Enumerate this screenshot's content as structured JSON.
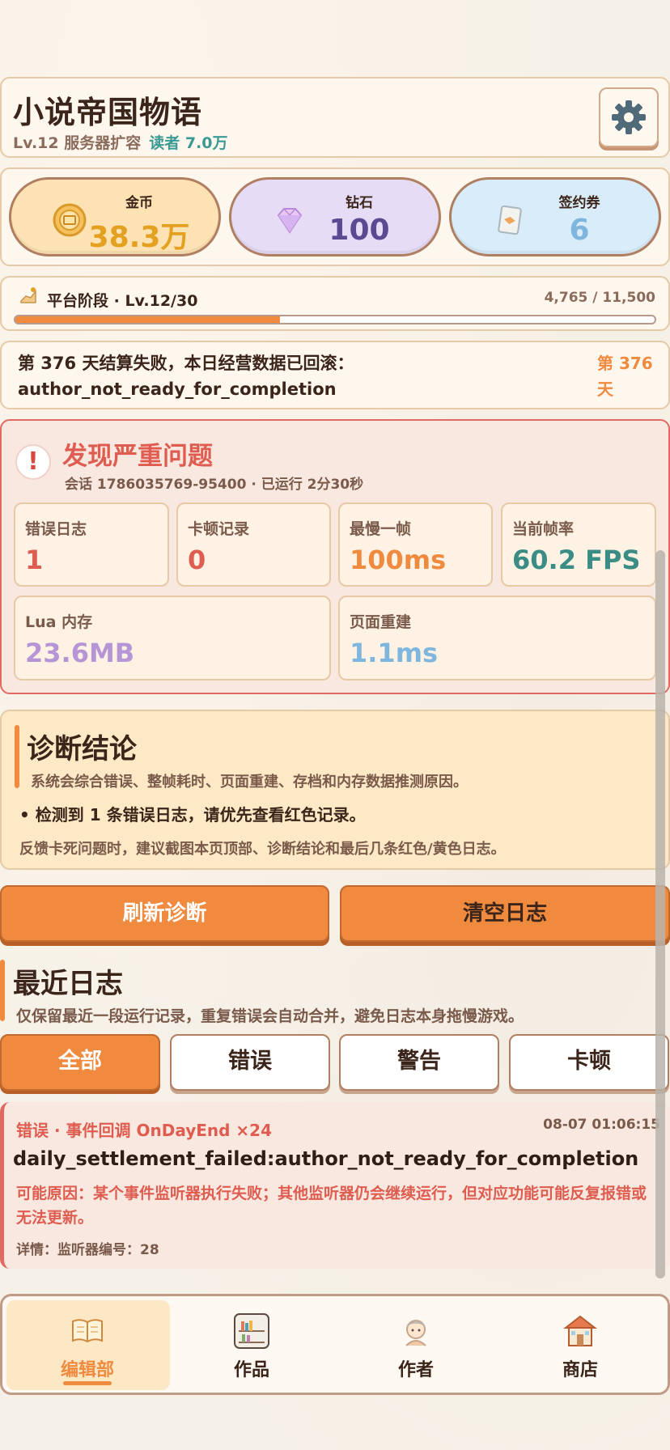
{
  "header": {
    "title": "小说帝国物语",
    "level_text": "Lv.12 服务器扩容",
    "readers_text": "读者 7.0万"
  },
  "currencies": {
    "gold": {
      "label": "金币",
      "value": "38.3万"
    },
    "gem": {
      "label": "钻石",
      "value": "100"
    },
    "ticket": {
      "label": "签约券",
      "value": "6"
    }
  },
  "stage": {
    "label": "平台阶段 · Lv.12/30",
    "count": "4,765 / 11,500",
    "progress": 0.414
  },
  "notice": {
    "text": "第 376 天结算失败，本日经营数据已回滚：author_not_ready_for_completion",
    "day": "第 376 天"
  },
  "problem": {
    "title": "发现严重问题",
    "session": "会话 1786035769-95400 · 已运行 2分30秒",
    "stats": [
      {
        "label": "错误日志",
        "value": "1"
      },
      {
        "label": "卡顿记录",
        "value": "0"
      },
      {
        "label": "最慢一帧",
        "value": "100ms"
      },
      {
        "label": "当前帧率",
        "value": "60.2 FPS"
      },
      {
        "label": "Lua 内存",
        "value": "23.6MB"
      },
      {
        "label": "页面重建",
        "value": "1.1ms"
      }
    ]
  },
  "diagnosis": {
    "title": "诊断结论",
    "subtitle": "系统会综合错误、整帧耗时、页面重建、存档和内存数据推测原因。",
    "bullet": "• 检测到 1 条错误日志，请优先查看红色记录。",
    "tip": "反馈卡死问题时，建议截图本页顶部、诊断结论和最后几条红色/黄色日志。"
  },
  "actions": {
    "refresh": "刷新诊断",
    "clear": "清空日志"
  },
  "logs": {
    "title": "最近日志",
    "subtitle": "仅保留最近一段运行记录，重复错误会自动合并，避免日志本身拖慢游戏。",
    "filters": [
      "全部",
      "错误",
      "警告",
      "卡顿"
    ],
    "entry": {
      "head": "错误 · 事件回调 OnDayEnd ×24",
      "time": "08-07 01:06:15",
      "message": "daily_settlement_failed:author_not_ready_for_completion",
      "cause": "可能原因：某个事件监听器执行失败；其他监听器仍会继续运行，但对应功能可能反复报错或无法更新。",
      "detail": "详情：监听器编号：28"
    }
  },
  "nav": [
    "编辑部",
    "作品",
    "作者",
    "商店"
  ],
  "colors": {
    "accent": "#ef8a3f",
    "error": "#df5c50",
    "teal": "#3a9a92",
    "purple_stat": "#b695d6",
    "blue_stat": "#7fb6de"
  }
}
